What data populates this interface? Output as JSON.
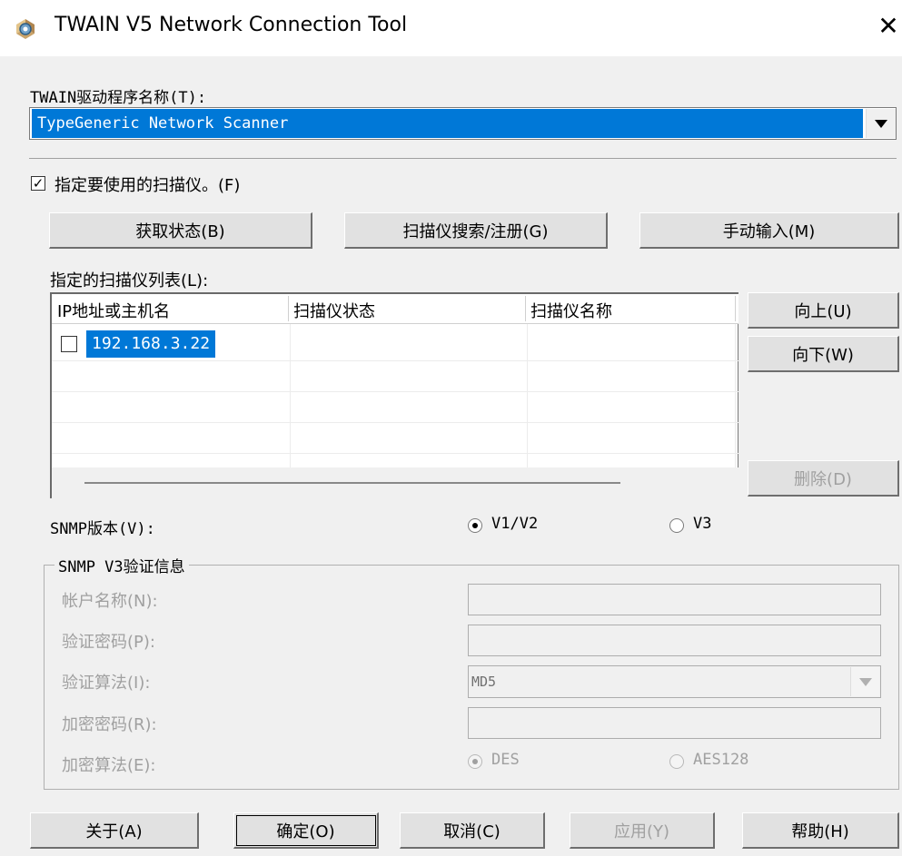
{
  "window": {
    "title": "TWAIN V5 Network Connection Tool",
    "close_glyph": "✕"
  },
  "driver": {
    "label": "TWAIN驱动程序名称(T):",
    "selected": "TypeGeneric Network Scanner"
  },
  "specify_checkbox": {
    "checked": true,
    "mark": "✓",
    "label": "指定要使用的扫描仪。(F)"
  },
  "action_buttons": {
    "get_status": "获取状态(B)",
    "search_register": "扫描仪搜索/注册(G)",
    "manual_input": "手动输入(M)"
  },
  "scanner_list": {
    "label": "指定的扫描仪列表(L):",
    "columns": [
      "IP地址或主机名",
      "扫描仪状态",
      "扫描仪名称"
    ],
    "rows": [
      {
        "ip": "192.168.3.22",
        "status": "",
        "name": "",
        "checked": false,
        "selected": true
      }
    ]
  },
  "side_buttons": {
    "up": "向上(U)",
    "down": "向下(W)",
    "delete": "删除(D)"
  },
  "snmp": {
    "label": "SNMP版本(V):",
    "options": [
      "V1/V2",
      "V3"
    ],
    "selected": "V1/V2"
  },
  "v3_group": {
    "title": "SNMP V3验证信息",
    "account_label": "帐户名称(N):",
    "auth_password_label": "验证密码(P):",
    "auth_algo_label": "验证算法(I):",
    "auth_algo_value": "MD5",
    "enc_password_label": "加密密码(R):",
    "enc_algo_label": "加密算法(E):",
    "enc_algo_options": [
      "DES",
      "AES128"
    ],
    "enc_algo_selected": "DES"
  },
  "bottom_buttons": {
    "about": "关于(A)",
    "ok": "确定(O)",
    "cancel": "取消(C)",
    "apply": "应用(Y)",
    "help": "帮助(H)"
  },
  "colors": {
    "selection": "#0078d7",
    "panel": "#f0f0f0",
    "disabled_text": "#a0a0a0"
  }
}
